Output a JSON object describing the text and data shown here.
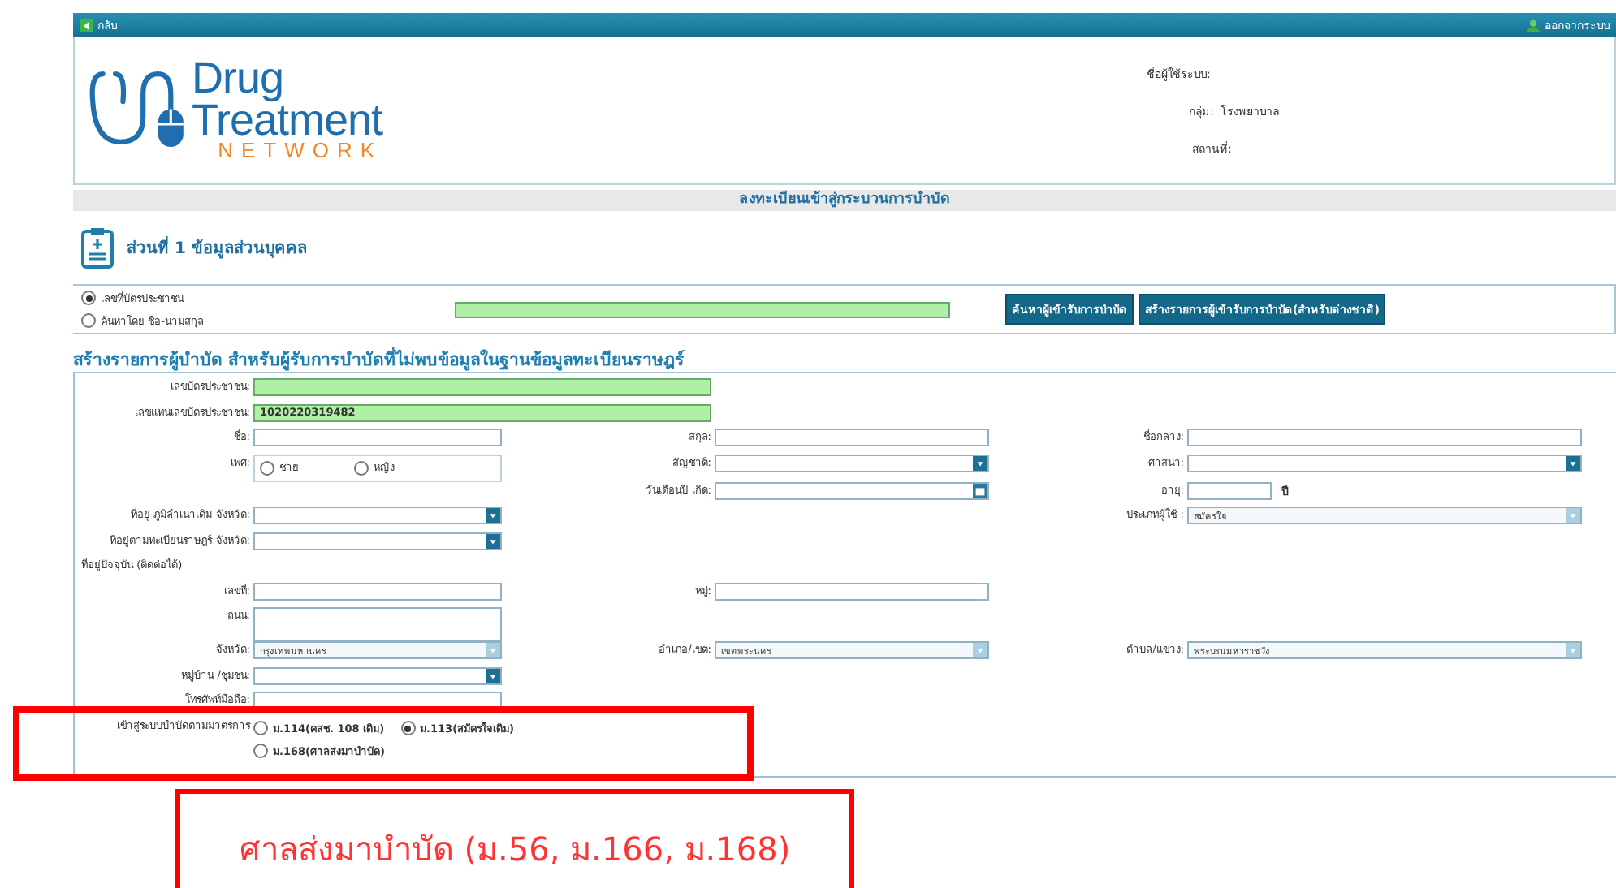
{
  "top_bar": {
    "back": "กลับ",
    "logout": "ออกจากระบบ"
  },
  "logo": {
    "line1": "Drug",
    "line2": "Treatment",
    "line3": "NETWORK"
  },
  "user_info": [
    {
      "label": "ชื่อผู้ใช้ระบบ:"
    },
    {
      "label": "กลุ่ม:",
      "value": "โรงพยาบาล"
    },
    {
      "label": "สถานที่:"
    }
  ],
  "page_title": "ลงทะเบียนเข้าสู่กระบวนการบำบัด",
  "section_title": "ส่วนที่ 1 ข้อมูลส่วนบุคคล",
  "search": {
    "options": [
      {
        "label": "เลขที่บัตรประชาชน",
        "selected": true
      },
      {
        "label": "ค้นหาโดย ชื่อ-นามสกุล",
        "selected": false
      }
    ],
    "buttons": [
      "ค้นหาผู้เข้ารับการบำบัด",
      "สร้างรายการผู้เข้ารับการบำบัด(สำหรับต่างชาติ)"
    ]
  },
  "form_title": "สร้างรายการผู้บำบัด สำหรับผู้รับการบำบัดที่ไม่พบข้อมูลในฐานข้อมูลทะเบียนราษฎร์",
  "form_rows": [
    {
      "left": {
        "kind": "id",
        "label": "เลขบัตรประชาชน:"
      }
    },
    {
      "left": {
        "kind": "id",
        "label": "เลขแทนเลขบัตรประชาชน:",
        "value": "1020220319482"
      }
    },
    {
      "left": {
        "kind": "text",
        "label": "ชื่อ:"
      },
      "middle": {
        "kind": "text",
        "label": "สกุล:"
      },
      "right": {
        "kind": "text",
        "label": "ชื่อกลาง:"
      }
    },
    {
      "left": {
        "kind": "radio",
        "label": "เพศ:",
        "options": [
          {
            "label": "ชาย",
            "selected": false
          },
          {
            "label": "หญิง",
            "selected": false
          }
        ]
      },
      "middle": {
        "kind": "select",
        "label": "สัญชาติ:",
        "disabled": false
      },
      "right": {
        "kind": "select",
        "label": "ศาสนา:",
        "disabled": false
      }
    },
    {
      "middle": {
        "kind": "date",
        "label": "วันเดือนปี เกิด:"
      },
      "right": {
        "kind": "age",
        "label": "อายุ:",
        "unit": "ปี"
      }
    },
    {
      "left": {
        "kind": "select",
        "label": "ที่อยู่ ภูมิลำเนาเดิม จังหวัด:",
        "disabled": false
      },
      "right": {
        "kind": "select",
        "label": "ประเภทผู้ใช้ :",
        "value": "สมัครใจ",
        "disabled": true
      }
    },
    {
      "left": {
        "kind": "select",
        "label": "ที่อยู่ตามทะเบียนราษฎร์ จังหวัด:",
        "disabled": false
      }
    },
    {
      "left": {
        "kind": "heading",
        "label": "ที่อยู่ปัจจุบัน (ติดต่อได้)"
      }
    },
    {
      "left": {
        "kind": "text",
        "label": "เลขที่:"
      },
      "middle": {
        "kind": "text",
        "label": "หมู่:"
      }
    },
    {
      "left": {
        "kind": "textarea",
        "label": "ถนน:"
      }
    },
    {
      "left": {
        "kind": "select",
        "label": "จังหวัด:",
        "value": "กรุงเทพมหานคร",
        "disabled": true
      },
      "middle": {
        "kind": "select",
        "label": "อำเภอ/เขต:",
        "value": "เขตพระนคร",
        "disabled": true
      },
      "right": {
        "kind": "select",
        "label": "ตำบล/แขวง:",
        "value": "พระบรมมหาราชวัง",
        "disabled": true
      }
    },
    {
      "left": {
        "kind": "select",
        "label": "หมู่บ้าน /ชุมชน:",
        "disabled": false
      }
    },
    {
      "left": {
        "kind": "text",
        "label": "โทรศัพท์มือถือ:"
      }
    },
    {
      "left": {
        "kind": "radio",
        "label": "เข้าสู่ระบบบำบัดตามมาตรการ",
        "options": [
          {
            "label": "ม.114(คสช. 108 เดิม)",
            "selected": false
          },
          {
            "label": "ม.113(สมัครใจเดิม)",
            "selected": true
          },
          {
            "label": "ม.168(ศาลส่งมาบำบัด)",
            "selected": false
          }
        ]
      }
    }
  ],
  "annotation": "ศาลส่งมาบำบัด (ม.56, ม.166, ม.168)"
}
